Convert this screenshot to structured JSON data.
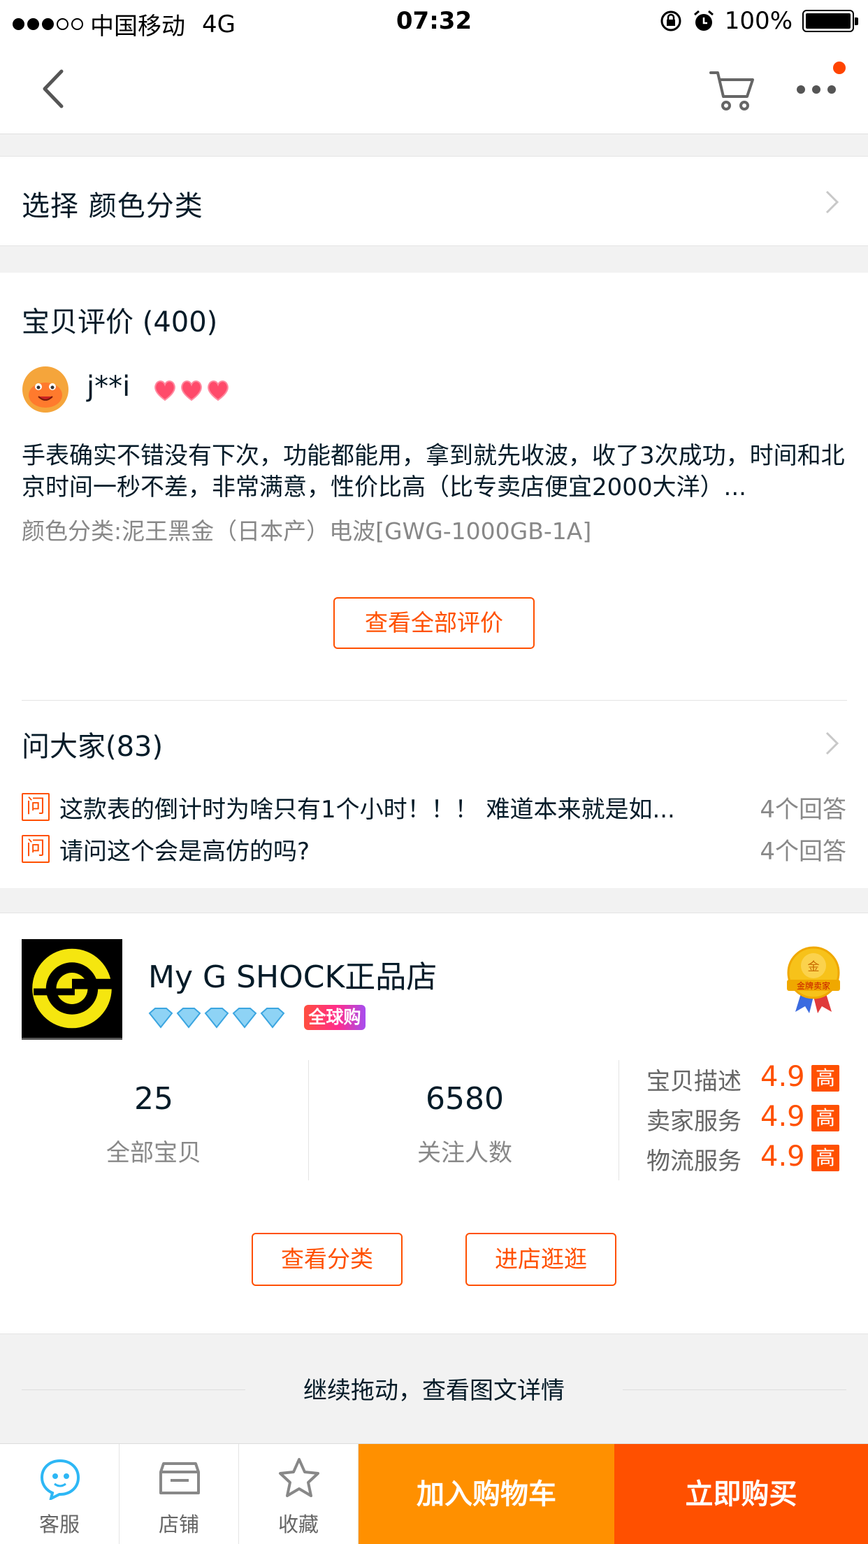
{
  "status_bar": {
    "carrier": "中国移动",
    "network": "4G",
    "time": "07:32",
    "battery": "100%"
  },
  "nav": {
    "back_icon": "chevron-left-icon",
    "cart_icon": "cart-icon",
    "more_icon": "more-icon"
  },
  "sku": {
    "label": "选择  颜色分类"
  },
  "reviews": {
    "title": "宝贝评价 (400)",
    "user": "j**i",
    "text": "手表确实不错没有下次，功能都能用，拿到就先收波，收了3次成功，时间和北京时间一秒不差，非常满意，性价比高（比专卖店便宜2000大洋）...",
    "sku_info": "颜色分类:泥王黑金（日本产）电波[GWG-1000GB-1A]",
    "view_all": "查看全部评价"
  },
  "qa": {
    "title": "问大家(83)",
    "badge": "问",
    "items": [
      {
        "question": "这款表的倒计时为啥只有1个小时！！！ 难道本来就是如...",
        "answers": "4个回答"
      },
      {
        "question": "请问这个会是高仿的吗?",
        "answers": "4个回答"
      }
    ]
  },
  "shop": {
    "name": "My G SHOCK正品店",
    "global_badge": "全球购",
    "medal_top": "金",
    "medal_text": "金牌卖家",
    "stats": [
      {
        "value": "25",
        "label": "全部宝贝"
      },
      {
        "value": "6580",
        "label": "关注人数"
      }
    ],
    "ratings": [
      {
        "label": "宝贝描述",
        "value": "4.9",
        "level": "高"
      },
      {
        "label": "卖家服务",
        "value": "4.9",
        "level": "高"
      },
      {
        "label": "物流服务",
        "value": "4.9",
        "level": "高"
      }
    ],
    "btn_category": "查看分类",
    "btn_enter": "进店逛逛"
  },
  "pull_hint": "继续拖动，查看图文详情",
  "tab_bar": {
    "service": "客服",
    "store": "店铺",
    "favorite": "收藏",
    "add_cart": "加入购物车",
    "buy_now": "立即购买"
  },
  "colors": {
    "accent": "#ff5000",
    "cart_orange": "#ff9000",
    "service_blue": "#2db7f5"
  }
}
